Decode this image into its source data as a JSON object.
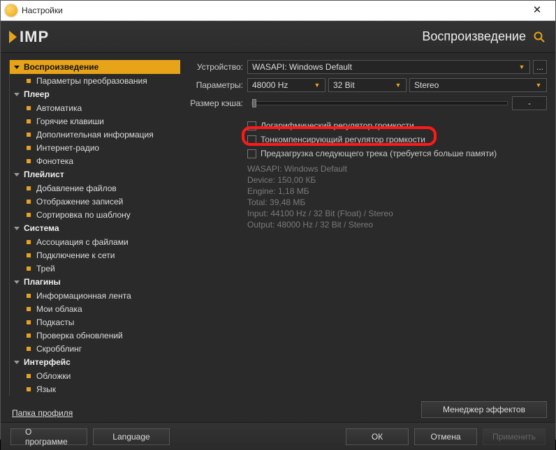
{
  "titlebar": {
    "title": "Настройки"
  },
  "header": {
    "logo_text": "IMP",
    "section": "Воспроизведение"
  },
  "sidebar": {
    "cats": [
      {
        "label": "Воспроизведение",
        "active": true,
        "items": [
          "Параметры преобразования"
        ]
      },
      {
        "label": "Плеер",
        "items": [
          "Автоматика",
          "Горячие клавиши",
          "Дополнительная информация",
          "Интернет-радио",
          "Фонотека"
        ]
      },
      {
        "label": "Плейлист",
        "items": [
          "Добавление файлов",
          "Отображение записей",
          "Сортировка по шаблону"
        ]
      },
      {
        "label": "Система",
        "items": [
          "Ассоциация с файлами",
          "Подключение к сети",
          "Трей"
        ]
      },
      {
        "label": "Плагины",
        "items": [
          "Информационная лента",
          "Мои облака",
          "Подкасты",
          "Проверка обновлений",
          "Скробблинг"
        ]
      },
      {
        "label": "Интерфейс",
        "items": [
          "Обложки",
          "Язык"
        ]
      }
    ],
    "profile": "Папка профиля"
  },
  "playback": {
    "device_lbl": "Устройство:",
    "device_val": "WASAPI: Windows Default",
    "params_lbl": "Параметры:",
    "sample_rate": "48000 Hz",
    "bit_depth": "32 Bit",
    "channels": "Stereo",
    "cache_lbl": "Размер кэша:",
    "cache_val": "-",
    "chk1": "Логарифмический регулятор громкости",
    "chk2": "Тонкомпенсирующий регулятор громкости",
    "chk3": "Предзагрузка следующего трека (требуется больше памяти)",
    "info": [
      "WASAPI: Windows Default",
      "Device: 150,00 КБ",
      "Engine: 1,18 МБ",
      "Total: 39,48 МБ",
      "Input: 44100 Hz / 32 Bit (Float) / Stereo",
      "Output: 48000 Hz / 32 Bit / Stereo"
    ],
    "effects_btn": "Менеджер эффектов"
  },
  "footer": {
    "about": "О программе",
    "lang": "Language",
    "ok": "ОК",
    "cancel": "Отмена",
    "apply": "Применить"
  }
}
